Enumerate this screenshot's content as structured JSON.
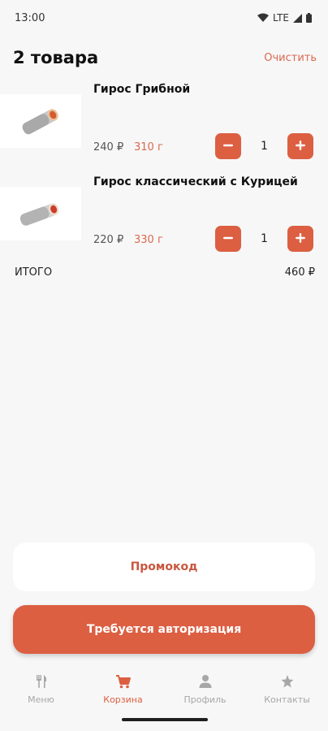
{
  "status_bar": {
    "time": "13:00",
    "network": "LTE"
  },
  "header": {
    "title": "2 товара",
    "clear_label": "Очистить"
  },
  "cart_items": [
    {
      "name": "Гирос Грибной",
      "price": "240 ₽",
      "weight": "310 г",
      "quantity": "1",
      "image": "gyros-wrap-image"
    },
    {
      "name": "Гирос классический с Курицей",
      "price": "220 ₽",
      "weight": "330 г",
      "quantity": "1",
      "image": "gyros-wrap-image"
    }
  ],
  "total": {
    "label": "ИТОГО",
    "value": "460 ₽"
  },
  "promo_button": {
    "label": "Промокод"
  },
  "auth_button": {
    "label": "Требуется авторизация"
  },
  "bottom_nav": [
    {
      "label": "Меню",
      "icon": "fork-knife-icon",
      "active": false
    },
    {
      "label": "Корзина",
      "icon": "cart-icon",
      "active": true
    },
    {
      "label": "Профиль",
      "icon": "person-icon",
      "active": false
    },
    {
      "label": "Контакты",
      "icon": "pin-icon",
      "active": false
    }
  ],
  "colors": {
    "accent": "#dc5f42",
    "background": "#f7f7f7",
    "inactive": "#a7a7a7"
  }
}
